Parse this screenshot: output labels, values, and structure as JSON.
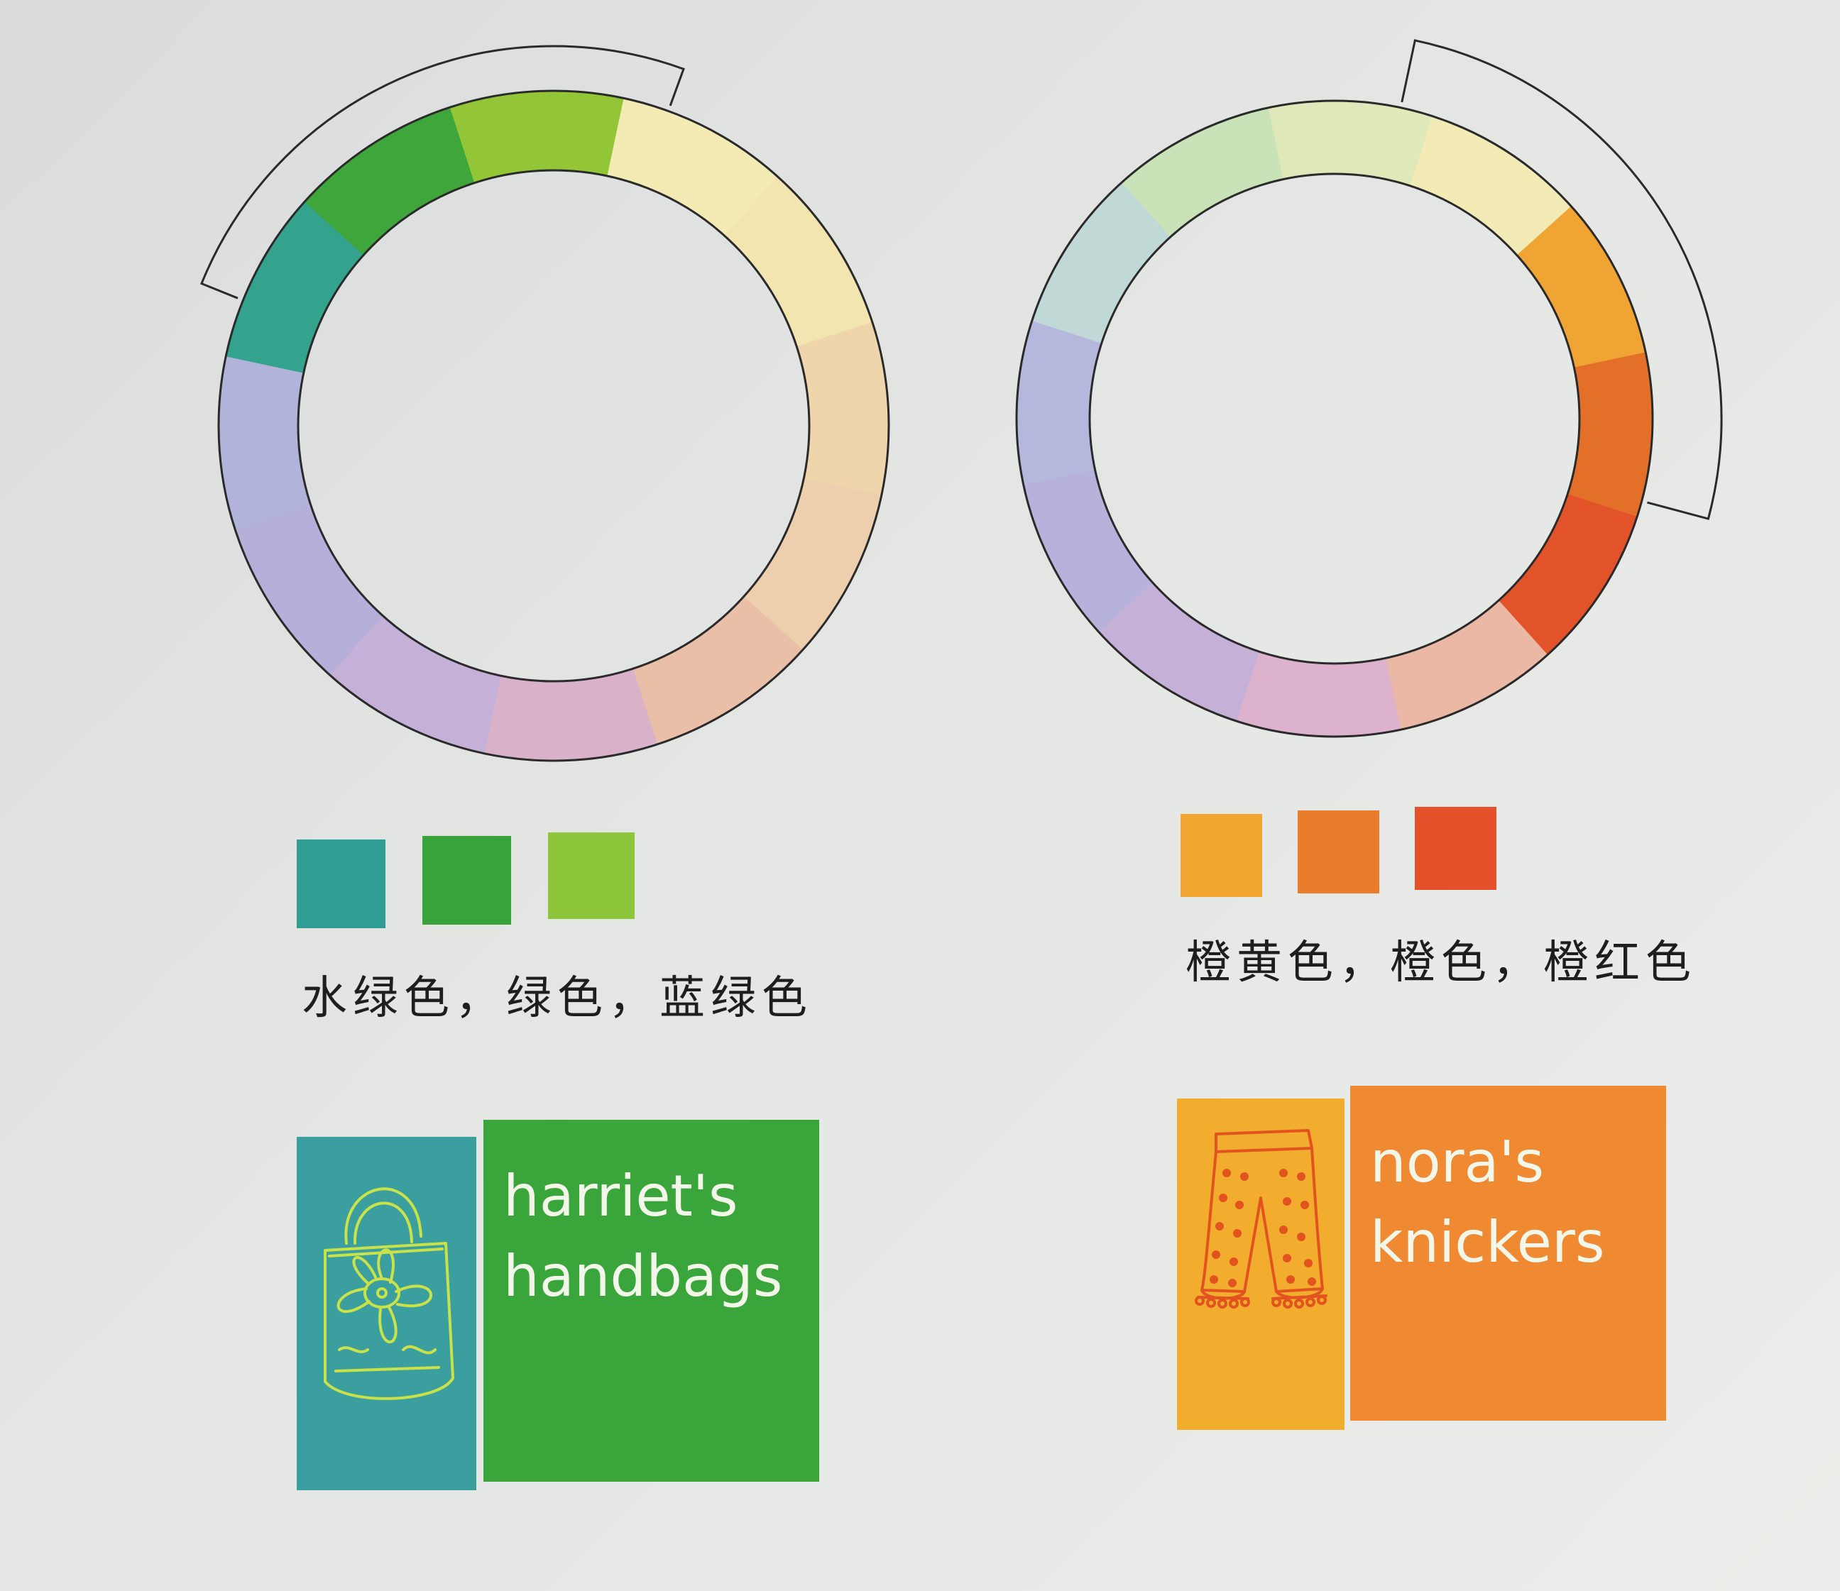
{
  "wheels": [
    {
      "id": "cool-wheel",
      "segments": [
        {
          "color": "#f3ebb3"
        },
        {
          "color": "#f2e5b0"
        },
        {
          "color": "#efd5ab"
        },
        {
          "color": "#edcfad"
        },
        {
          "color": "#eabfa7"
        },
        {
          "color": "#d9b2ca"
        },
        {
          "color": "#c5b0d8"
        },
        {
          "color": "#b5b0d9"
        },
        {
          "color": "#b1b3da"
        },
        {
          "color": "#34a38e"
        },
        {
          "color": "#3ea63a"
        },
        {
          "color": "#92c637"
        }
      ]
    },
    {
      "id": "warm-wheel",
      "segments": [
        {
          "color": "#f0a433"
        },
        {
          "color": "#e46f28"
        },
        {
          "color": "#e2532a"
        },
        {
          "color": "#ebb8a5"
        },
        {
          "color": "#ddb2cc"
        },
        {
          "color": "#c5b0d8"
        },
        {
          "color": "#b7b2dc"
        },
        {
          "color": "#b5b7dc"
        },
        {
          "color": "#c0d8d6"
        },
        {
          "color": "#c9e2b8"
        },
        {
          "color": "#dfe8b8"
        },
        {
          "color": "#f2ebb6"
        }
      ]
    }
  ],
  "left": {
    "swatches": [
      {
        "name": "teal",
        "color": "#2f9d93"
      },
      {
        "name": "green",
        "color": "#38a23b"
      },
      {
        "name": "lime",
        "color": "#8ec63b"
      }
    ],
    "caption": "水绿色，绿色，蓝绿色",
    "logo": {
      "icon_color": "#3a9f9e",
      "text_color": "#3aa53a",
      "line1": "harriet's",
      "line2": "handbags",
      "icon": "handbag-icon"
    }
  },
  "right": {
    "swatches": [
      {
        "name": "orange-yellow",
        "color": "#f2a530"
      },
      {
        "name": "orange",
        "color": "#e97d2c"
      },
      {
        "name": "orange-red",
        "color": "#e3502a"
      }
    ],
    "caption": "橙黄色，橙色，橙红色",
    "logo": {
      "icon_color": "#f2ad2f",
      "text_color": "#ef8a33",
      "line1": "nora's",
      "line2": "knickers",
      "icon": "knickers-icon"
    }
  }
}
